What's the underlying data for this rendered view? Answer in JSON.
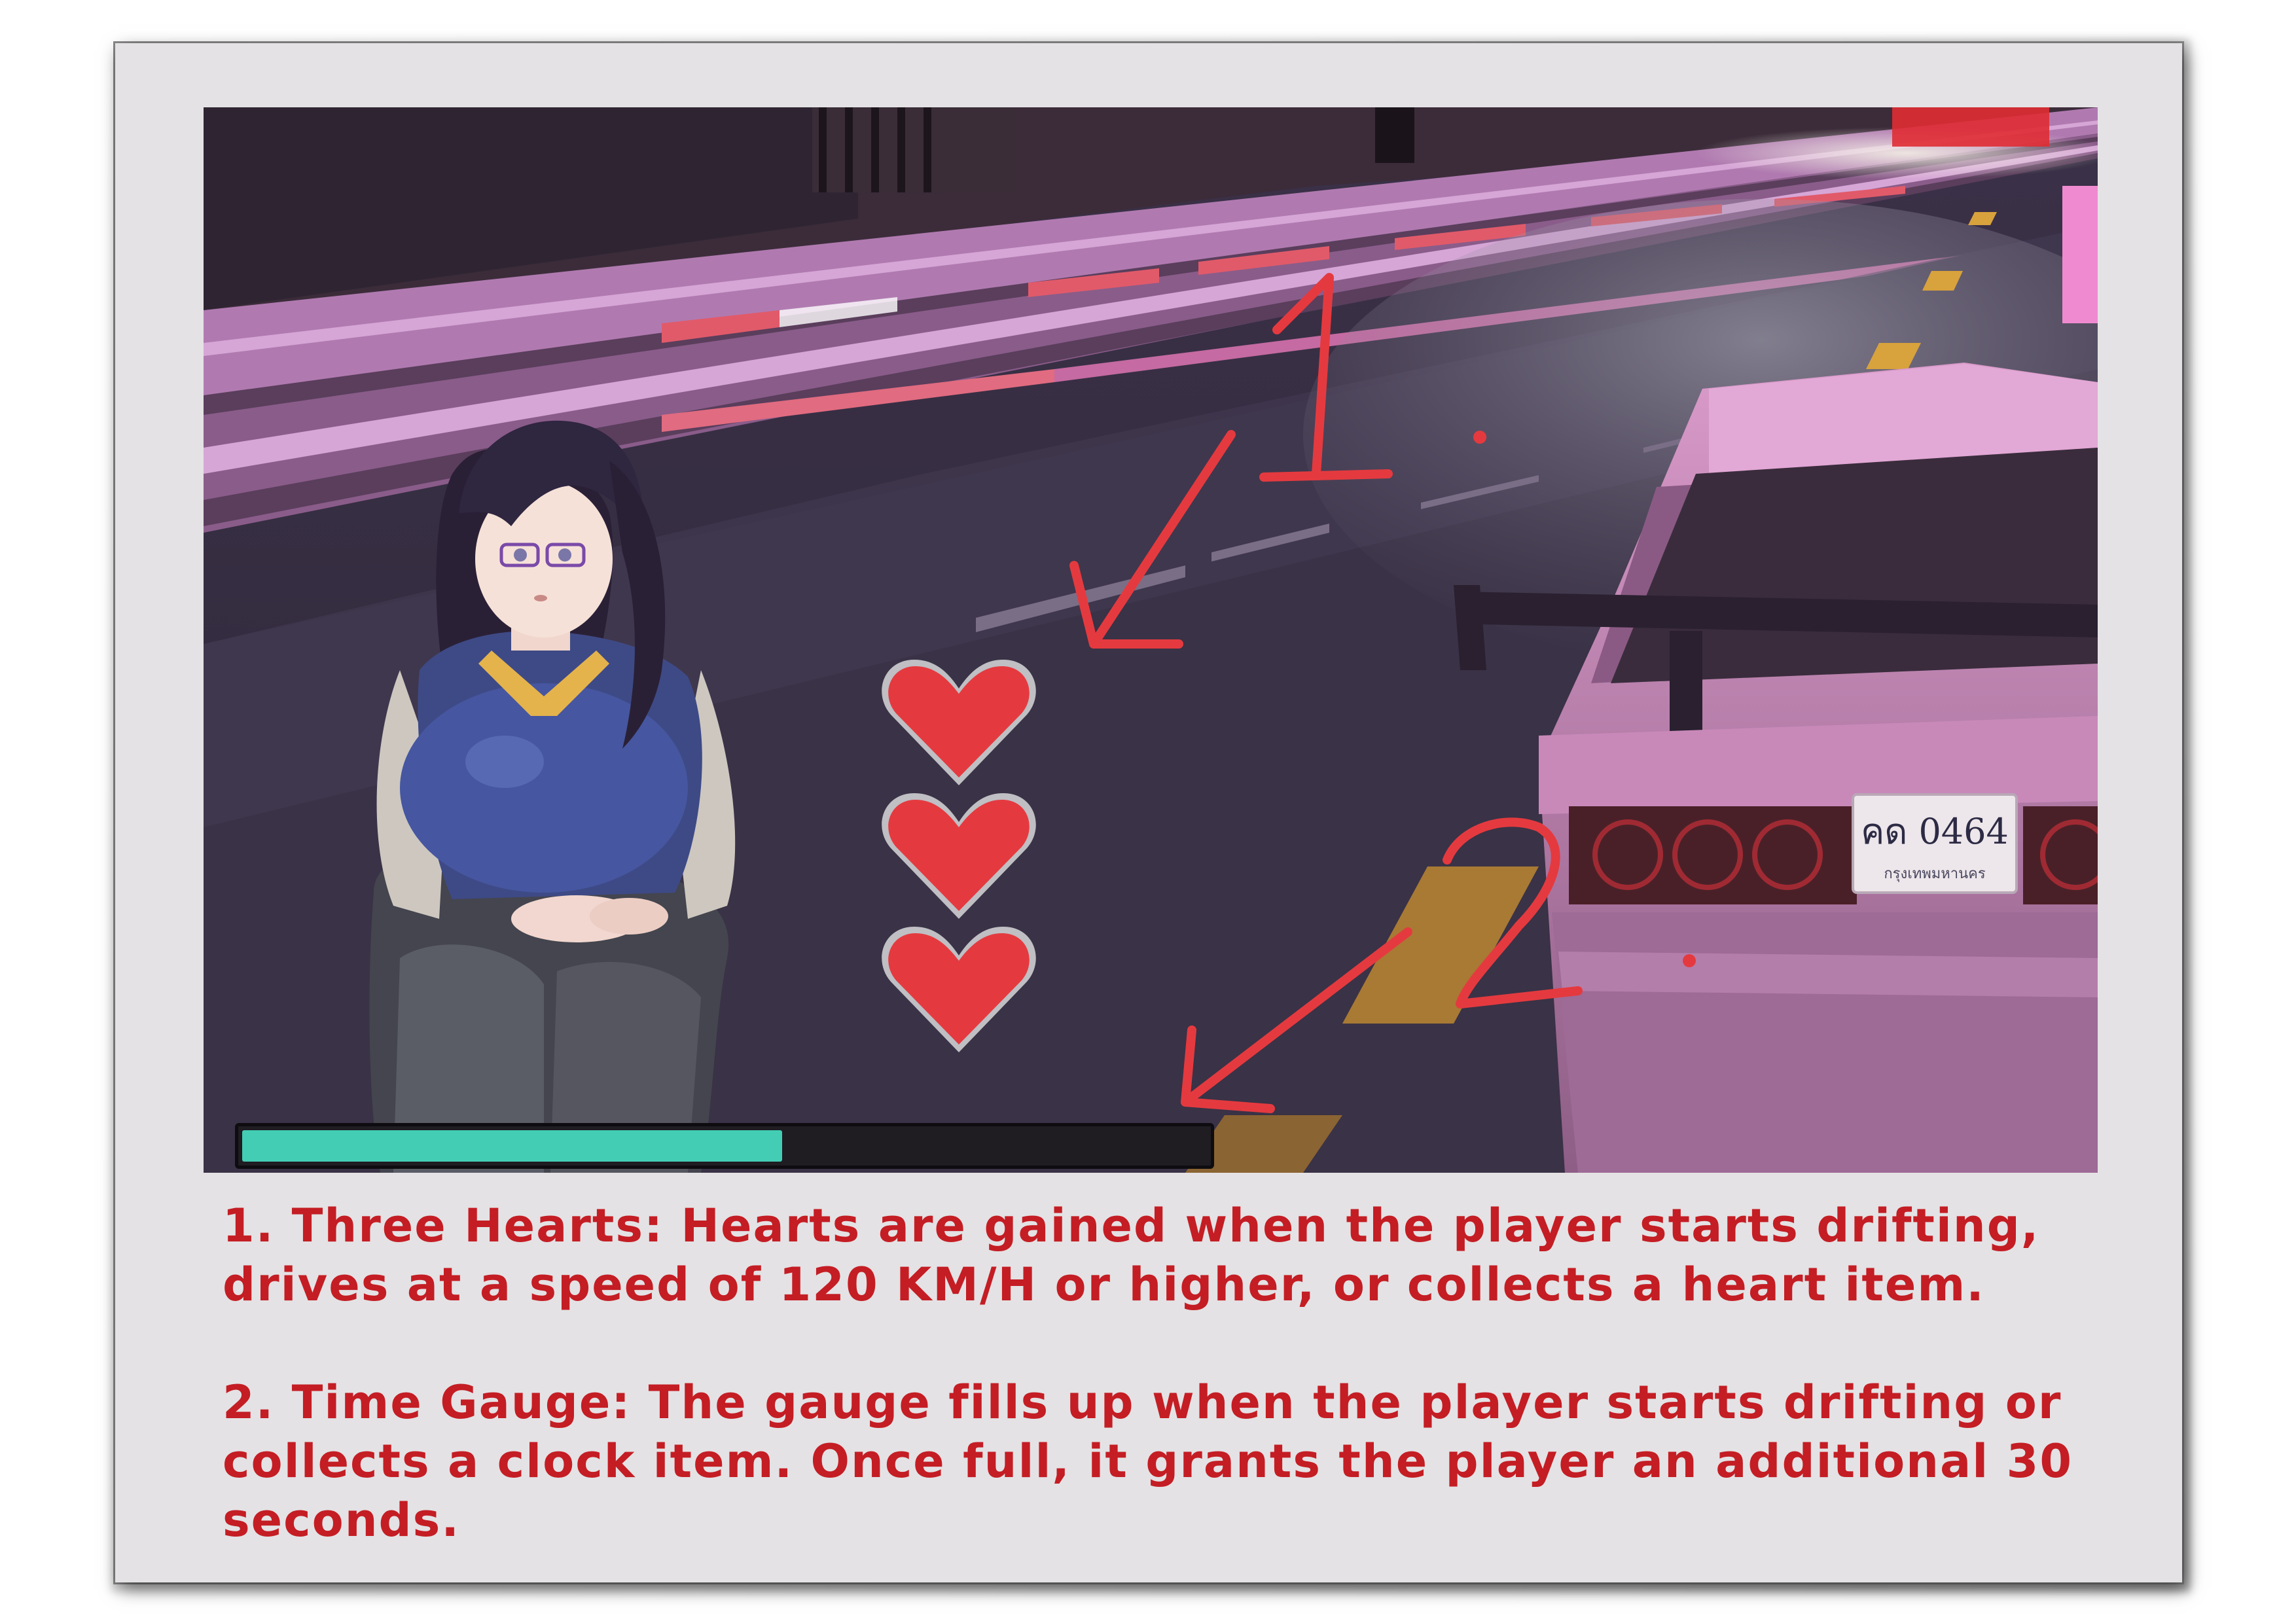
{
  "scene": {
    "license_plate": {
      "number": "คด 0464",
      "province": "กรุงเทพมหานคร"
    },
    "hearts": {
      "count": 3,
      "icon": "heart-icon",
      "color": "#e43a3f"
    },
    "time_gauge": {
      "fill_fraction": 0.56,
      "fill_color": "#43cdb5"
    }
  },
  "annotations": {
    "one": "1.",
    "two": "2.",
    "color": "#e43a3f"
  },
  "captions": {
    "item1_line1": "1. Three Hearts: Hearts are gained when the player starts drifting,",
    "item1_line2": "drives at a speed of 120 KM/H or higher, or collects a heart item.",
    "item2_line1": "2. Time Gauge: The gauge fills up when the player starts drifting or",
    "item2_line2": "collects a clock item. Once full, it grants the player an additional 30",
    "item2_line3": "seconds."
  }
}
